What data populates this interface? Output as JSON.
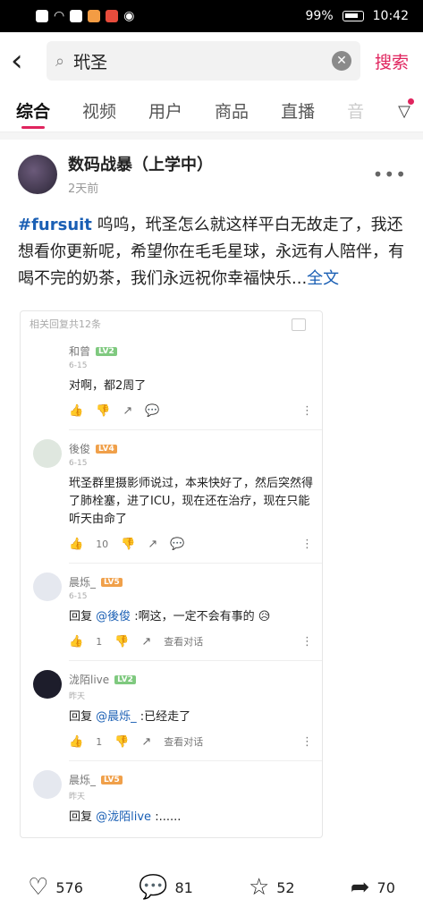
{
  "status_bar": {
    "battery": "99%",
    "time": "10:42"
  },
  "search": {
    "query": "玳圣",
    "button_label": "搜索"
  },
  "tabs": [
    "综合",
    "视频",
    "用户",
    "商品",
    "直播",
    "音"
  ],
  "post": {
    "author": "数码战暴（上学中）",
    "time": "2天前",
    "hashtag": "#fursuit",
    "text": " 呜呜，玳圣怎么就这样平白无故走了，我还想看你更新呢，希望你在毛毛星球，永远有人陪伴，有喝不完的奶茶，我们永远祝你幸福快乐...",
    "full_label": "全文"
  },
  "screenshot": {
    "header": "相关回复共12条",
    "comments": [
      {
        "name": "和曾",
        "level": "LV2",
        "date": "6-15",
        "text": "对啊，都2周了",
        "likes": ""
      },
      {
        "name": "後俊",
        "level": "LV4",
        "date": "6-15",
        "text": "玳圣群里摄影师说过，本来快好了，然后突然得了肺栓塞，进了ICU，现在还在治疗，现在只能听天由命了",
        "likes": "10"
      },
      {
        "name": "晨烁_",
        "level": "LV5",
        "date": "6-15",
        "reply_prefix": "回复 ",
        "mention": "@後俊",
        "text": " :啊这，一定不会有事的 😥",
        "likes": "1",
        "view_thread": "查看对话"
      },
      {
        "name": "泷陌live",
        "level": "LV2",
        "date": "昨天",
        "reply_prefix": "回复 ",
        "mention": "@晨烁_",
        "text": " :已经走了",
        "likes": "1",
        "view_thread": "查看对话"
      },
      {
        "name": "晨烁_",
        "level": "LV5",
        "date": "昨天",
        "reply_prefix": "回复 ",
        "mention": "@泷陌live",
        "text": " :......",
        "likes": ""
      }
    ]
  },
  "bottom_bar": {
    "likes": "576",
    "comments": "81",
    "favorites": "52",
    "shares": "70"
  }
}
